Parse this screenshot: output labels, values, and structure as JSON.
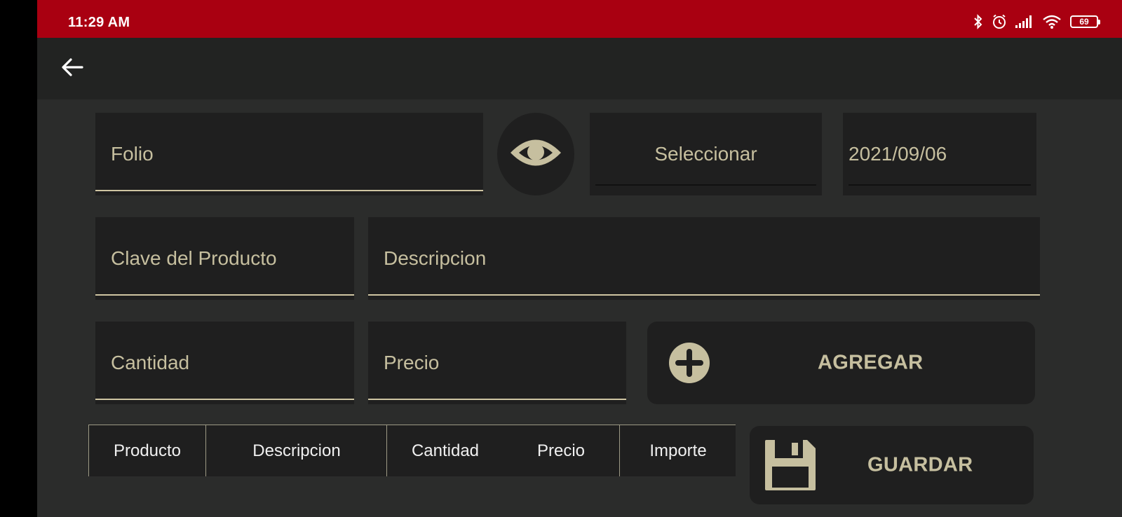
{
  "status_bar": {
    "time": "11:29 AM",
    "battery": "69"
  },
  "form": {
    "folio_label": "Folio",
    "select_label": "Seleccionar",
    "date_value": "2021/09/06",
    "clave_label": "Clave del Producto",
    "descripcion_label": "Descripcion",
    "cantidad_label": "Cantidad",
    "precio_label": "Precio"
  },
  "buttons": {
    "agregar_label": "AGREGAR",
    "guardar_label": "GUARDAR"
  },
  "table": {
    "columns": [
      "Producto",
      "Descripcion",
      "Cantidad",
      "Precio",
      "Importe"
    ]
  },
  "colors": {
    "status_bar": "#a90011",
    "accent": "#c6bf9f",
    "field_background": "#1f1f1f",
    "screen_background": "#2b2c2b"
  },
  "icons": {
    "back": "arrow-left-icon",
    "view": "eye-icon",
    "add": "plus-circle-icon",
    "save": "floppy-disk-icon"
  }
}
